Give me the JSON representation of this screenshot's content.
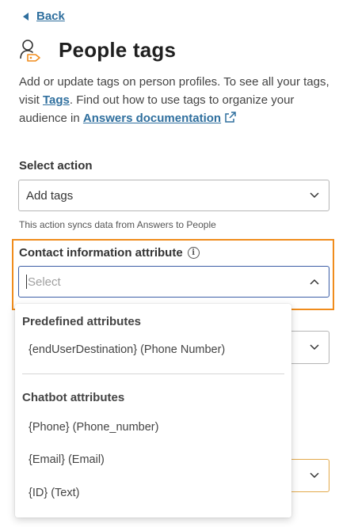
{
  "nav": {
    "back_label": "Back"
  },
  "header": {
    "title": "People tags",
    "icon": "person-tag-icon"
  },
  "description": {
    "part1": "Add or update tags on person profiles. To see all your tags, visit ",
    "tags_link": "Tags",
    "part2": ". Find out how to use tags to organize your audience in ",
    "docs_link": "Answers documentation"
  },
  "select_action": {
    "label": "Select action",
    "value": "Add tags",
    "note": "This action syncs data from Answers to People"
  },
  "contact_attribute": {
    "label": "Contact information attribute",
    "placeholder": "Select",
    "highlight_color": "#f08c1c"
  },
  "dropdown": {
    "groups": [
      {
        "title": "Predefined attributes",
        "options": [
          "{endUserDestination} (Phone Number)"
        ]
      },
      {
        "title": "Chatbot attributes",
        "options": [
          "{Phone} (Phone_number)",
          "{Email} (Email)",
          "{ID} (Text)"
        ]
      }
    ]
  },
  "colors": {
    "link": "#2f6f9e",
    "focus_border": "#3c5ea6"
  }
}
